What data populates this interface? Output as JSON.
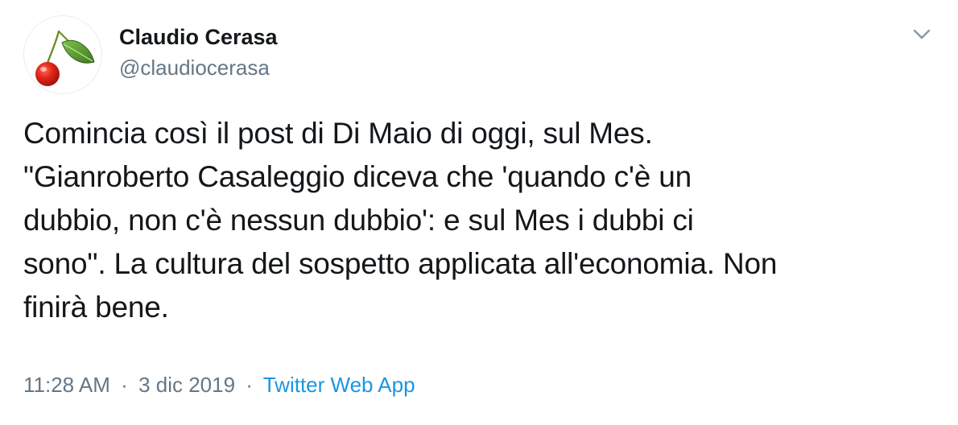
{
  "tweet": {
    "author": {
      "display_name": "Claudio Cerasa",
      "screen_name": "@claudiocerasa",
      "avatar_icon": "cherry-icon"
    },
    "text": "Comincia così il post di Di Maio di oggi, sul Mes.\n\"Gianroberto Casaleggio diceva che 'quando c'è un\ndubbio, non c'è nessun dubbio': e sul Mes i dubbi ci\nsono\". La cultura del sospetto applicata all'economia. Non\nfinirà bene.",
    "time": "11:28 AM",
    "separator": "·",
    "date": "3 dic 2019",
    "source": "Twitter Web App",
    "menu_icon": "chevron-down-icon"
  },
  "colors": {
    "text": "#14171a",
    "secondary": "#657786",
    "link": "#1b95e0",
    "cherry": "#d9261c",
    "leaf": "#5a9a2e"
  }
}
